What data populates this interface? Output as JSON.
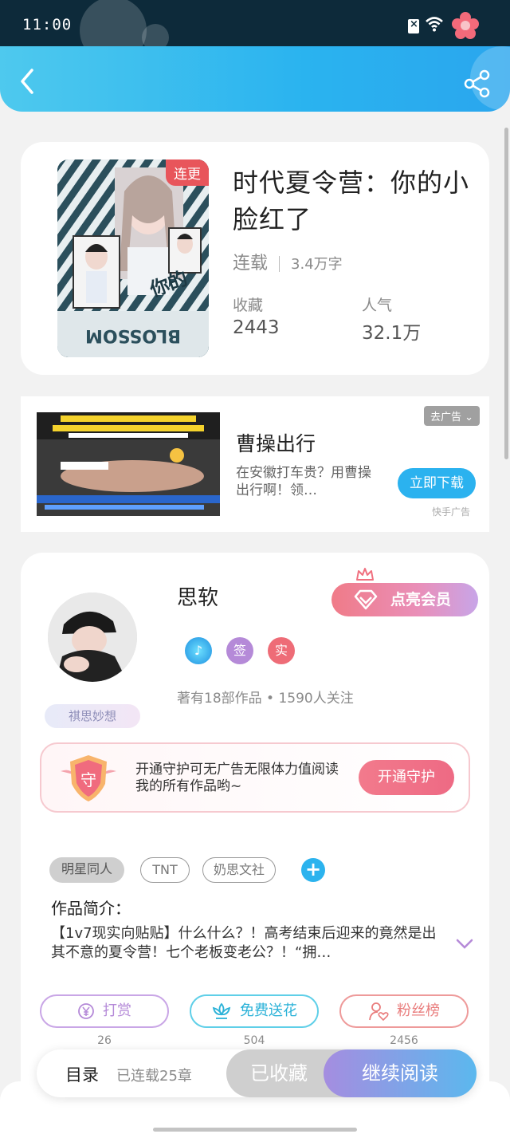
{
  "status": {
    "time": "11:00"
  },
  "book": {
    "cover_tag": "连更",
    "title": "时代夏令营：你的小脸红了",
    "status": "连载",
    "words": "3.4万字",
    "collect_label": "收藏",
    "collect_value": "2443",
    "popularity_label": "人气",
    "popularity_value": "32.1万"
  },
  "ad": {
    "close_label": "去广告",
    "title": "曹操出行",
    "desc": "在安徽打车贵？用曹操出行啊！领…",
    "download_label": "立即下载",
    "source": "快手广告"
  },
  "author": {
    "name": "思软",
    "vip_label": "点亮会员",
    "badges": [
      "签",
      "实"
    ],
    "stats": "著有18部作品 • 1590人关注",
    "tag": "祺思妙想",
    "guard_shield": "守",
    "guard_text": "开通守护可无广告无限体力值阅读我的所有作品哟~",
    "guard_button": "开通守护"
  },
  "tags": [
    "明星同人",
    "TNT",
    "奶思文社"
  ],
  "intro": {
    "label": "作品简介：",
    "text": "【1v7现实向贴贴】什么什么？！高考结束后迎来的竟然是出其不意的夏令营！七个老板变老公？！“拥…"
  },
  "actions": [
    {
      "label": "打赏",
      "count": "26",
      "color": "#b58ad8"
    },
    {
      "label": "免费送花",
      "count": "504",
      "color": "#3dc4e6"
    },
    {
      "label": "粉丝榜",
      "count": "2456",
      "color": "#e97d7d"
    }
  ],
  "bottom": {
    "toc": "目录",
    "toc_sub": "已连载25章",
    "fav": "已收藏",
    "read": "继续阅读"
  }
}
